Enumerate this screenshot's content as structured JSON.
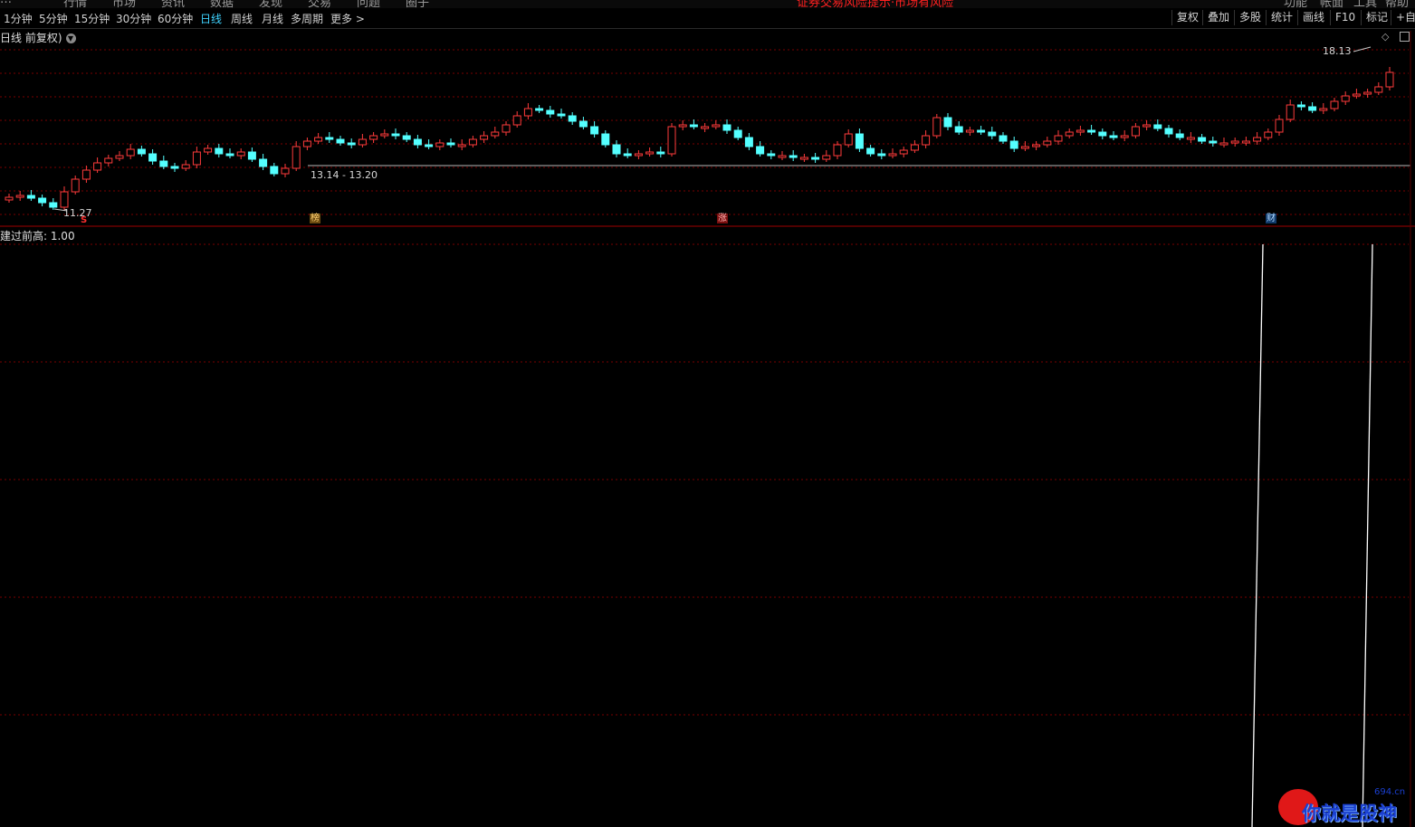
{
  "top_menu": [
    "…",
    "行情",
    "市场",
    "资讯",
    "数据",
    "发现",
    "交易",
    "问题",
    "圈子"
  ],
  "top_warning": "证券交易风险提示·市场有风险",
  "top_right": [
    "功能",
    "帐面",
    "工具",
    "帮助"
  ],
  "period_tabs": [
    {
      "label": "1分钟",
      "active": false
    },
    {
      "label": "5分钟",
      "active": false
    },
    {
      "label": "15分钟",
      "active": false
    },
    {
      "label": "30分钟",
      "active": false
    },
    {
      "label": "60分钟",
      "active": false
    },
    {
      "label": "日线",
      "active": true
    },
    {
      "label": "周线",
      "active": false
    },
    {
      "label": "月线",
      "active": false
    },
    {
      "label": "多周期",
      "active": false
    },
    {
      "label": "更多 >",
      "active": false
    }
  ],
  "right_tools": [
    "复权",
    "叠加",
    "多股",
    "统计",
    "画线",
    "F10",
    "标记",
    "+自选"
  ],
  "chart": {
    "title": "日线 前复权)",
    "dropdown_icon": "chevron-down-icon",
    "high_label": "18.13",
    "low_label": "11.27",
    "range_label": "13.14 - 13.20",
    "markers": [
      "S",
      "榜",
      "涨",
      "财"
    ],
    "up_color": "#ff3b3b",
    "down_color": "#54ffff",
    "grid_color": "#7a0000"
  },
  "indicator": {
    "label": "建过前高: 1.00",
    "line_color": "#ffffff"
  },
  "watermark": {
    "text": "你就是股神",
    "url": "694.cn"
  }
}
